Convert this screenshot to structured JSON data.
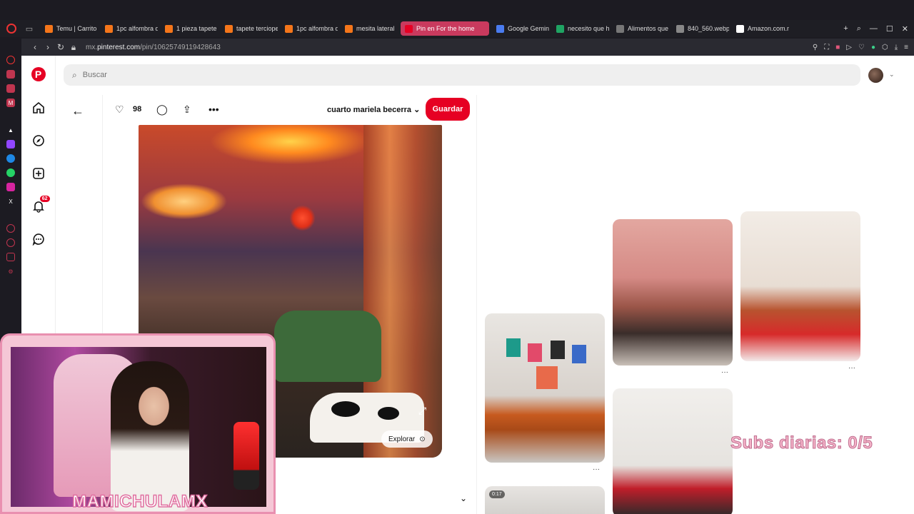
{
  "browser": {
    "tabs": [
      {
        "label": "Temu | Carrito",
        "fav_color": "#f5761a",
        "active": false
      },
      {
        "label": "1pc alfombra d",
        "fav_color": "#f5761a",
        "active": false
      },
      {
        "label": "1 pieza tapete",
        "fav_color": "#f5761a",
        "active": false
      },
      {
        "label": "tapete terciope",
        "fav_color": "#f5761a",
        "active": false
      },
      {
        "label": "1pc alfombra d",
        "fav_color": "#f5761a",
        "active": false
      },
      {
        "label": "mesita lateral",
        "fav_color": "#f5761a",
        "active": false
      },
      {
        "label": "Pin en For the home",
        "fav_color": "#e60023",
        "active": true
      },
      {
        "label": "Google Gemini",
        "fav_color": "#4a7cf0",
        "active": false
      },
      {
        "label": "necesito que h",
        "fav_color": "#1fa463",
        "active": false
      },
      {
        "label": "Alimentos que",
        "fav_color": "#777777",
        "active": false
      },
      {
        "label": "840_560.webp",
        "fav_color": "#888888",
        "active": false
      },
      {
        "label": "Amazon.com.m",
        "fav_color": "#ffffff",
        "active": false
      }
    ],
    "url_prefix": "mx.",
    "url_domain": "pinterest.com",
    "url_path": "/pin/10625749119428643"
  },
  "search": {
    "placeholder": "Buscar"
  },
  "pin": {
    "likes": "98",
    "board_name": "cuarto mariela becerra",
    "save_label": "Guardar",
    "explore_label": "Explorar"
  },
  "notifications": {
    "count": "62"
  },
  "grid": {
    "video_duration": "0:17"
  },
  "overlay": {
    "subs_text": "Subs diarias: 0/5",
    "streamer_name": "MAMICHULAMX"
  },
  "colors": {
    "pinterest_red": "#e60023",
    "active_tab": "#c93a5e"
  }
}
